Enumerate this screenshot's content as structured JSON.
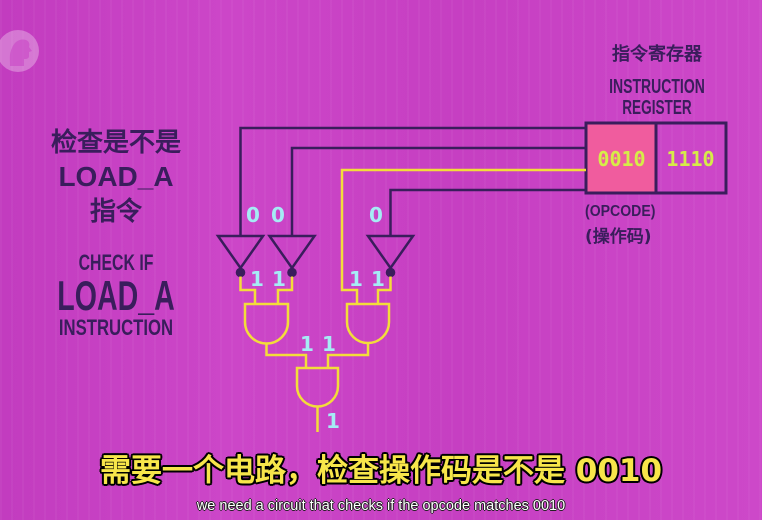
{
  "left_panel": {
    "zh_lines": [
      "检查是不是",
      "LOAD_A",
      "指令"
    ],
    "en_lines": [
      "CHECK IF",
      "LOAD_A",
      "INSTRUCTION"
    ]
  },
  "register": {
    "zh_title": "指令寄存器",
    "title_lines": [
      "INSTRUCTION",
      "REGISTER"
    ],
    "opcode": "0010",
    "operand": "1110",
    "opcode_label": "(OPCODE)",
    "opcode_label_zh": "(操作码)"
  },
  "circuit": {
    "bits": {
      "input_1": "0",
      "input_2": "0",
      "input_4": "0",
      "not_1_out": "1",
      "not_2_out": "1",
      "input_3": "1",
      "not_4_out": "1",
      "and_1_out": "1",
      "and_2_out": "1",
      "final_out": "1"
    }
  },
  "subtitles": {
    "zh": "需要一个电路，检查操作码是不是 0010",
    "en": "we need a circuit that checks if the opcode matches 0010"
  },
  "icons": {
    "logo": "pbs-logo"
  },
  "colors": {
    "bg": "#c941c4",
    "ink": "#3a1d5c",
    "active": "#f3dd3a",
    "bit": "#a5ecf5",
    "regval": "#d6ec48",
    "opfill": "#f05c9e",
    "sub": "#f7e64a",
    "suben": "#ffffff"
  }
}
